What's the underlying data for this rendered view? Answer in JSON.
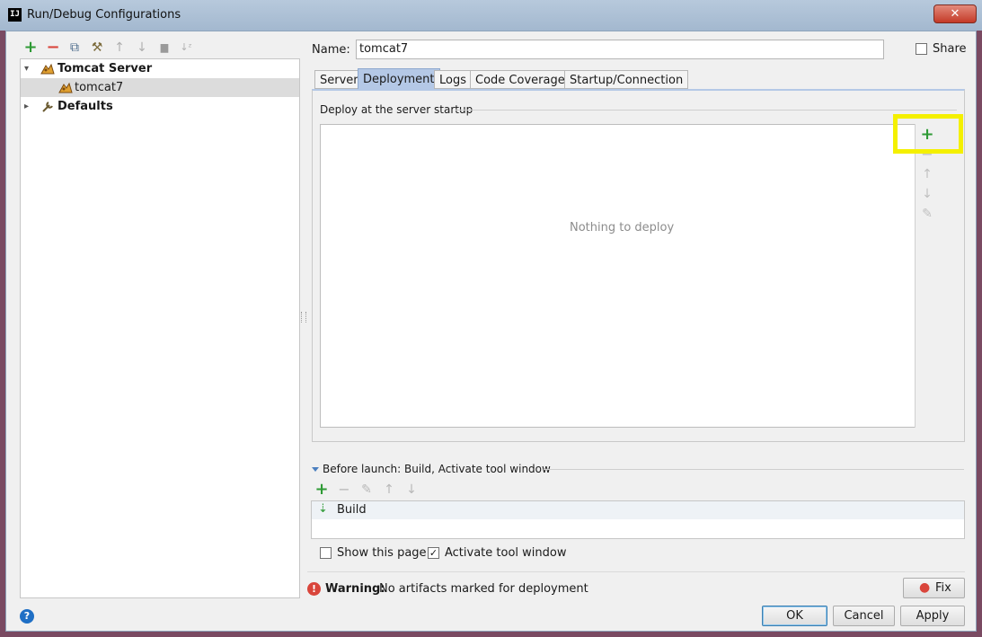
{
  "window": {
    "title": "Run/Debug Configurations",
    "app_icon_text": "IJ",
    "close_glyph": "✕"
  },
  "left_toolbar": {
    "icons": [
      "add-icon",
      "remove-icon",
      "copy-icon",
      "edit-defaults-icon",
      "move-up-icon",
      "move-down-icon",
      "folder-icon",
      "sort-icon"
    ],
    "add_glyph": "+",
    "remove_glyph": "−",
    "copy_glyph": "⧉",
    "wrench_glyph": "⚒",
    "up_glyph": "↑",
    "down_glyph": "↓",
    "folder_glyph": "▆",
    "sort_glyph": "↓ᶻ"
  },
  "tree": {
    "items": [
      {
        "label": "Tomcat Server",
        "expanded": true,
        "bold": true
      },
      {
        "label": "tomcat7",
        "selected": true
      },
      {
        "label": "Defaults",
        "expanded": false,
        "bold": true
      }
    ]
  },
  "config": {
    "name_label": "Name:",
    "name_value": "tomcat7",
    "share_label": "Share",
    "share_checked": false
  },
  "tabs": [
    {
      "label": "Server",
      "active": false
    },
    {
      "label": "Deployment",
      "active": true
    },
    {
      "label": "Logs",
      "active": false
    },
    {
      "label": "Code Coverage",
      "active": false
    },
    {
      "label": "Startup/Connection",
      "active": false
    }
  ],
  "deployment": {
    "section_title": "Deploy at the server startup",
    "empty_text": "Nothing to deploy",
    "toolbar_glyphs": {
      "add": "+",
      "remove": "−",
      "up": "↑",
      "down": "↓",
      "edit": "✎"
    }
  },
  "before_launch": {
    "title": "Before launch: Build, Activate tool window",
    "items": [
      {
        "label": "Build"
      }
    ],
    "toolbar_glyphs": {
      "add": "+",
      "remove": "−",
      "edit": "✎",
      "up": "↑",
      "down": "↓"
    },
    "build_icon_glyph": "⇣"
  },
  "options": {
    "show_page_label": "Show this page",
    "show_page_checked": false,
    "activate_label": "Activate tool window",
    "activate_checked": true,
    "check_glyph": "✓"
  },
  "warning": {
    "label": "Warning:",
    "text": "No artifacts marked for deployment",
    "icon_glyph": "!",
    "fix_label": "Fix",
    "fix_icon_glyph": "●"
  },
  "footer": {
    "help_glyph": "?",
    "ok_label": "OK",
    "cancel_label": "Cancel",
    "apply_label": "Apply"
  },
  "colors": {
    "accent": "#b4c8e6",
    "highlight": "#f4f000",
    "add_green": "#2e9a35",
    "remove_red": "#d9453b"
  }
}
